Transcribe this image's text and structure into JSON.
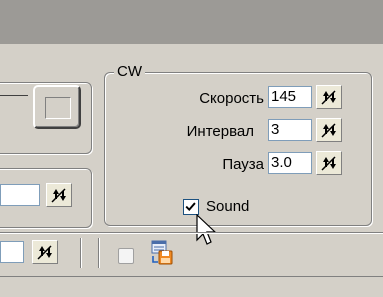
{
  "cw_group": {
    "title": "CW",
    "speed": {
      "label": "Скорость",
      "value": "145"
    },
    "interval": {
      "label": "Интервал",
      "value": "3"
    },
    "pause": {
      "label": "Пауза",
      "value": "3.0"
    },
    "sound": {
      "label": "Sound",
      "checked": true
    }
  },
  "left_panel": {
    "field1_value": "",
    "field2_value": ""
  },
  "toolbar": {
    "toggle_checked": false
  },
  "colors": {
    "window_bg": "#d4d0c8",
    "top_band": "#9c9a96",
    "field_border": "#7f9db9"
  }
}
